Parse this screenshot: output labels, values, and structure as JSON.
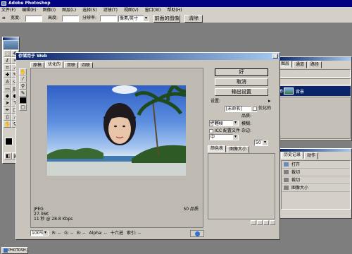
{
  "app": {
    "title": "Adobe Photoshop"
  },
  "menu": [
    "文件(F)",
    "编辑(E)",
    "图像(I)",
    "图层(L)",
    "选择(S)",
    "滤镜(T)",
    "视图(V)",
    "窗口(W)",
    "帮助(H)"
  ],
  "options": {
    "width_label": "宽度:",
    "height_label": "高度:",
    "resolution_label": "分辨率:",
    "units": "像素/英寸",
    "front_image": "前面的图像",
    "clear": "清除"
  },
  "dialog": {
    "title": "存储用于 Web",
    "tabs": [
      "原稿",
      "优化的",
      "双联",
      "四联"
    ],
    "buttons": {
      "ok": "好",
      "cancel": "取消",
      "output": "输出设置"
    },
    "settings_label": "设置:",
    "settings_value": "[未命名]",
    "format": "JPEG",
    "optimized": "优化的",
    "quality_preset": "中",
    "quality_label": "品质:",
    "quality_value": "50",
    "progressive": "连续",
    "blur_label": "模糊:",
    "blur_value": "0",
    "icc": "ICC 配置文件",
    "matte_label": "杂边:",
    "panel_tabs": [
      "颜色表",
      "图像大小"
    ],
    "info_format": "JPEG",
    "info_size": "27.36K",
    "info_time": "11 秒 @ 28.8 Kbps",
    "info_quality": "50 品质",
    "zoom": "100%",
    "r": "R: --",
    "g": "G: --",
    "b": "B: --",
    "alpha": "Alpha: --",
    "hex": "十六进",
    "index": "索引: --"
  },
  "layers": {
    "tabs": [
      "图层",
      "通道",
      "路径"
    ],
    "layer_name": "背景"
  },
  "history": {
    "tabs": [
      "历史记录",
      "动作"
    ],
    "items": [
      "打开",
      "裁切",
      "裁切",
      "图像大小"
    ]
  },
  "taskbar": {
    "start": "PHOTOSH..."
  },
  "colors": {
    "desktop": "#7e7e7e",
    "title_blue": "#0a246a",
    "panel": "#d4d0c8"
  }
}
